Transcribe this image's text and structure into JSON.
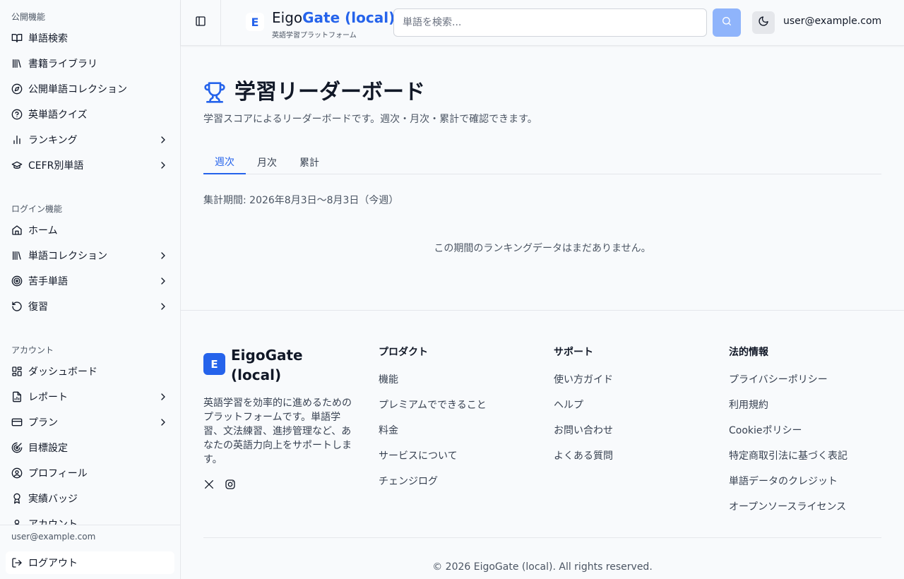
{
  "sidebar": {
    "groups": [
      {
        "label": "公開機能",
        "items": [
          {
            "label": "単語検索",
            "icon": "book-open-icon",
            "chevron": false
          },
          {
            "label": "書籍ライブラリ",
            "icon": "library-icon",
            "chevron": false
          },
          {
            "label": "公開単語コレクション",
            "icon": "compass-icon",
            "chevron": false
          },
          {
            "label": "英単語クイズ",
            "icon": "help-circle-icon",
            "chevron": false
          },
          {
            "label": "ランキング",
            "icon": "bar-chart-icon",
            "chevron": true
          },
          {
            "label": "CEFR別単語",
            "icon": "graduation-cap-icon",
            "chevron": true
          }
        ]
      },
      {
        "label": "ログイン機能",
        "items": [
          {
            "label": "ホーム",
            "icon": "home-icon",
            "chevron": false
          },
          {
            "label": "単語コレクション",
            "icon": "library-icon",
            "chevron": true
          },
          {
            "label": "苦手単語",
            "icon": "target-icon",
            "chevron": true
          },
          {
            "label": "復習",
            "icon": "rotate-ccw-icon",
            "chevron": true
          }
        ]
      },
      {
        "label": "アカウント",
        "items": [
          {
            "label": "ダッシュボード",
            "icon": "dashboard-icon",
            "chevron": false
          },
          {
            "label": "レポート",
            "icon": "file-chart-icon",
            "chevron": true
          },
          {
            "label": "プラン",
            "icon": "credit-card-icon",
            "chevron": true
          },
          {
            "label": "目標設定",
            "icon": "goal-icon",
            "chevron": false
          },
          {
            "label": "プロフィール",
            "icon": "user-circle-icon",
            "chevron": false
          },
          {
            "label": "実績バッジ",
            "icon": "award-icon",
            "chevron": false
          },
          {
            "label": "アカウント",
            "icon": "user-icon",
            "chevron": false
          }
        ]
      }
    ],
    "footer_email": "user@example.com",
    "logout_label": "ログアウト"
  },
  "header": {
    "logo_letter": "E",
    "brand_part1": "Eigo",
    "brand_part2": "Gate (local)",
    "brand_sub": "英語学習プラットフォーム",
    "search_placeholder": "単語を検索...",
    "user_email": "user@example.com",
    "accent_color": "#2563eb"
  },
  "main": {
    "title": "学習リーダーボード",
    "description": "学習スコアによるリーダーボードです。週次・月次・累計で確認できます。",
    "tabs": [
      "週次",
      "月次",
      "累計"
    ],
    "active_tab": 0,
    "period": "集計期間: 2026年8月3日〜8月3日（今週）",
    "empty_message": "この期間のランキングデータはまだありません。"
  },
  "footer": {
    "logo_letter": "E",
    "brand": "EigoGate (local)",
    "description": "英語学習を効率的に進めるためのプラットフォームです。単語学習、文法練習、進捗管理など、あなたの英語力向上をサポートします。",
    "social": [
      "x-icon",
      "instagram-icon"
    ],
    "columns": [
      {
        "heading": "プロダクト",
        "links": [
          "機能",
          "プレミアムでできること",
          "料金",
          "サービスについて",
          "チェンジログ"
        ]
      },
      {
        "heading": "サポート",
        "links": [
          "使い方ガイド",
          "ヘルプ",
          "お問い合わせ",
          "よくある質問"
        ]
      },
      {
        "heading": "法的情報",
        "links": [
          "プライバシーポリシー",
          "利用規約",
          "Cookieポリシー",
          "特定商取引法に基づく表記",
          "単語データのクレジット",
          "オープンソースライセンス"
        ]
      }
    ],
    "copyright": "© 2026 EigoGate (local). All rights reserved."
  }
}
